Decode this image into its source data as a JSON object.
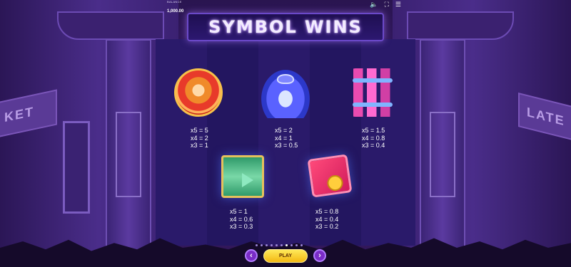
{
  "header": {
    "balance_label": "BALANCE",
    "balance_value": "1,000.00",
    "icons": [
      "speaker-icon",
      "fullscreen-icon",
      "menu-icon"
    ]
  },
  "title": "SYMBOL WINS",
  "symbols": [
    {
      "name": "drum",
      "icon": "drum-icon",
      "payouts": [
        "x5 = 5",
        "x4 = 2",
        "x3 = 1"
      ]
    },
    {
      "name": "teapot",
      "icon": "teapot-icon",
      "payouts": [
        "x5 = 2",
        "x4 = 1",
        "x3 = 0.5"
      ]
    },
    {
      "name": "firecrackers",
      "icon": "firecrackers-icon",
      "payouts": [
        "x5 = 1.5",
        "x4 = 0.8",
        "x3 = 0.4"
      ]
    },
    {
      "name": "scroll",
      "icon": "scroll-icon",
      "payouts": [
        "x5 = 1",
        "x4 = 0.6",
        "x3 = 0.3"
      ]
    },
    {
      "name": "red-envelope",
      "icon": "red-envelope-icon",
      "payouts": [
        "x5 = 0.8",
        "x4 = 0.4",
        "x3 = 0.2"
      ]
    }
  ],
  "background_signs": {
    "left": "KET",
    "right": "LATE"
  },
  "pagination": {
    "total_pages": 10,
    "current_page": 7
  },
  "controls": {
    "prev_label": "‹",
    "play_label": "PLAY",
    "next_label": "›"
  },
  "colors": {
    "accent": "#7a2cc7",
    "play_button": "#f7cf2a",
    "panel": "#2a1a6a"
  }
}
